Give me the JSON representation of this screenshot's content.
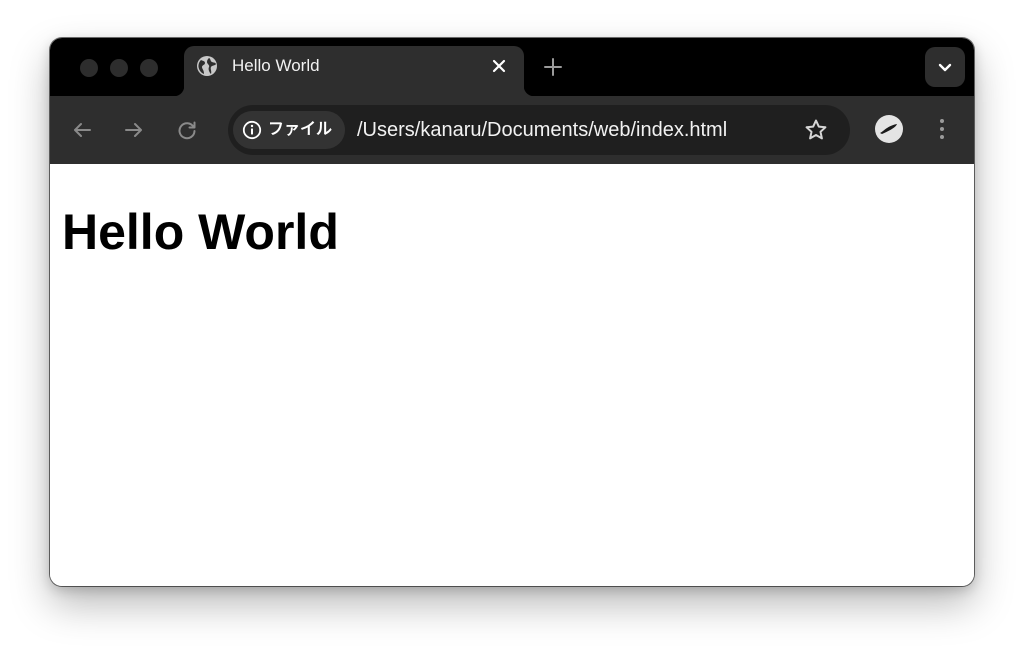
{
  "tab": {
    "title": "Hello World",
    "favicon_icon": "globe-icon"
  },
  "address_bar": {
    "scheme_chip_label": "ファイル",
    "scheme_chip_icon": "info-icon",
    "url": "/Users/kanaru/Documents/web/index.html"
  },
  "page": {
    "heading": "Hello World"
  },
  "colors": {
    "titlebar": "#000000",
    "tab_active": "#2e2e2e",
    "toolbar": "#2e2e2e",
    "omnibox": "#1f1f1f",
    "chip": "#333333",
    "page_background": "#ffffff"
  }
}
